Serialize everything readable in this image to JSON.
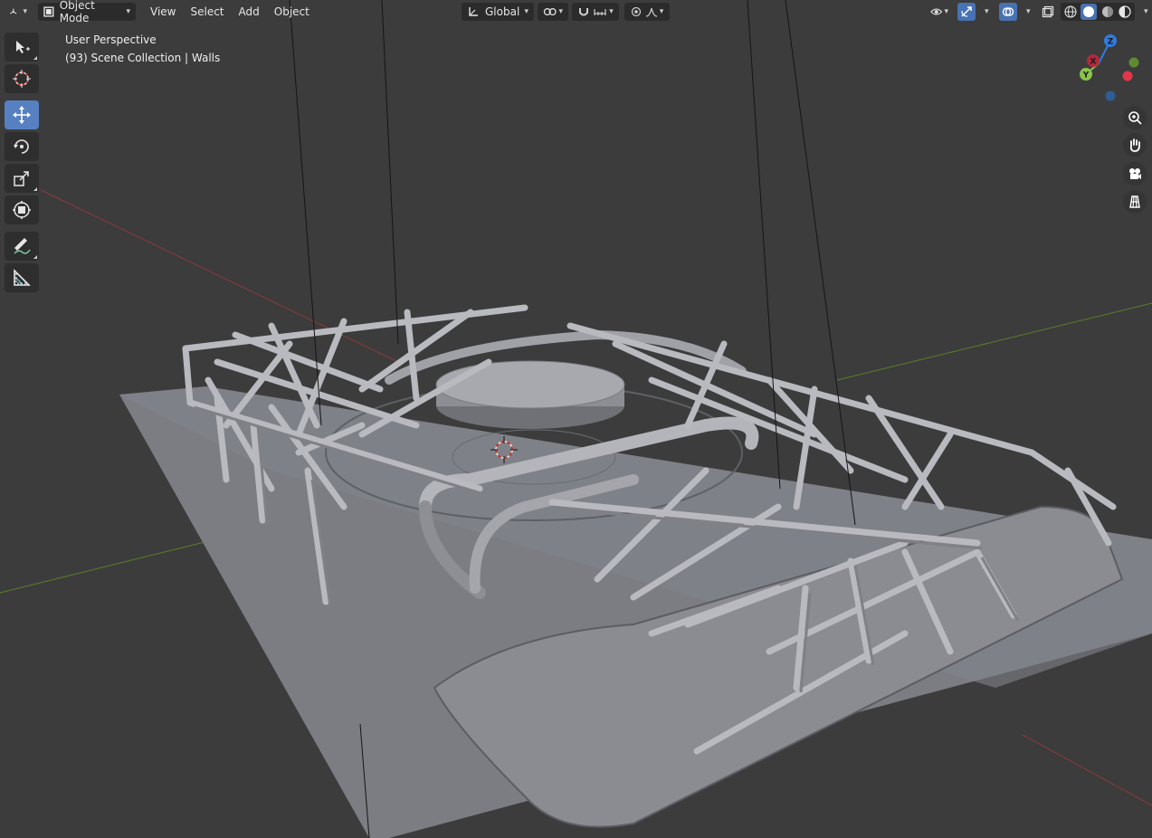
{
  "header": {
    "mode": "Object Mode",
    "menus": [
      "View",
      "Select",
      "Add",
      "Object"
    ],
    "transform_orientation": "Global"
  },
  "viewport": {
    "perspective_label": "User Perspective",
    "collection_label": "(93) Scene Collection | Walls"
  },
  "toolbar": {
    "tools": [
      "select-box",
      "cursor",
      "move",
      "rotate",
      "scale",
      "transform",
      "annotate",
      "measure"
    ],
    "active_tool": "move"
  },
  "gizmo": {
    "axes": [
      {
        "label": "Z",
        "color": "#2f7be0"
      },
      {
        "label": "Y",
        "color": "#8bc34a"
      },
      {
        "label": "X",
        "color": "#e3364b"
      }
    ]
  },
  "navigation": [
    "zoom-icon",
    "hand-pan-icon",
    "camera-icon",
    "grid-ortho-icon"
  ],
  "colors": {
    "accent": "#4772b3",
    "x_axis": "#e3364b",
    "y_axis": "#8bc34a",
    "z_axis": "#2f7be0",
    "background": "#3c3c3c"
  }
}
